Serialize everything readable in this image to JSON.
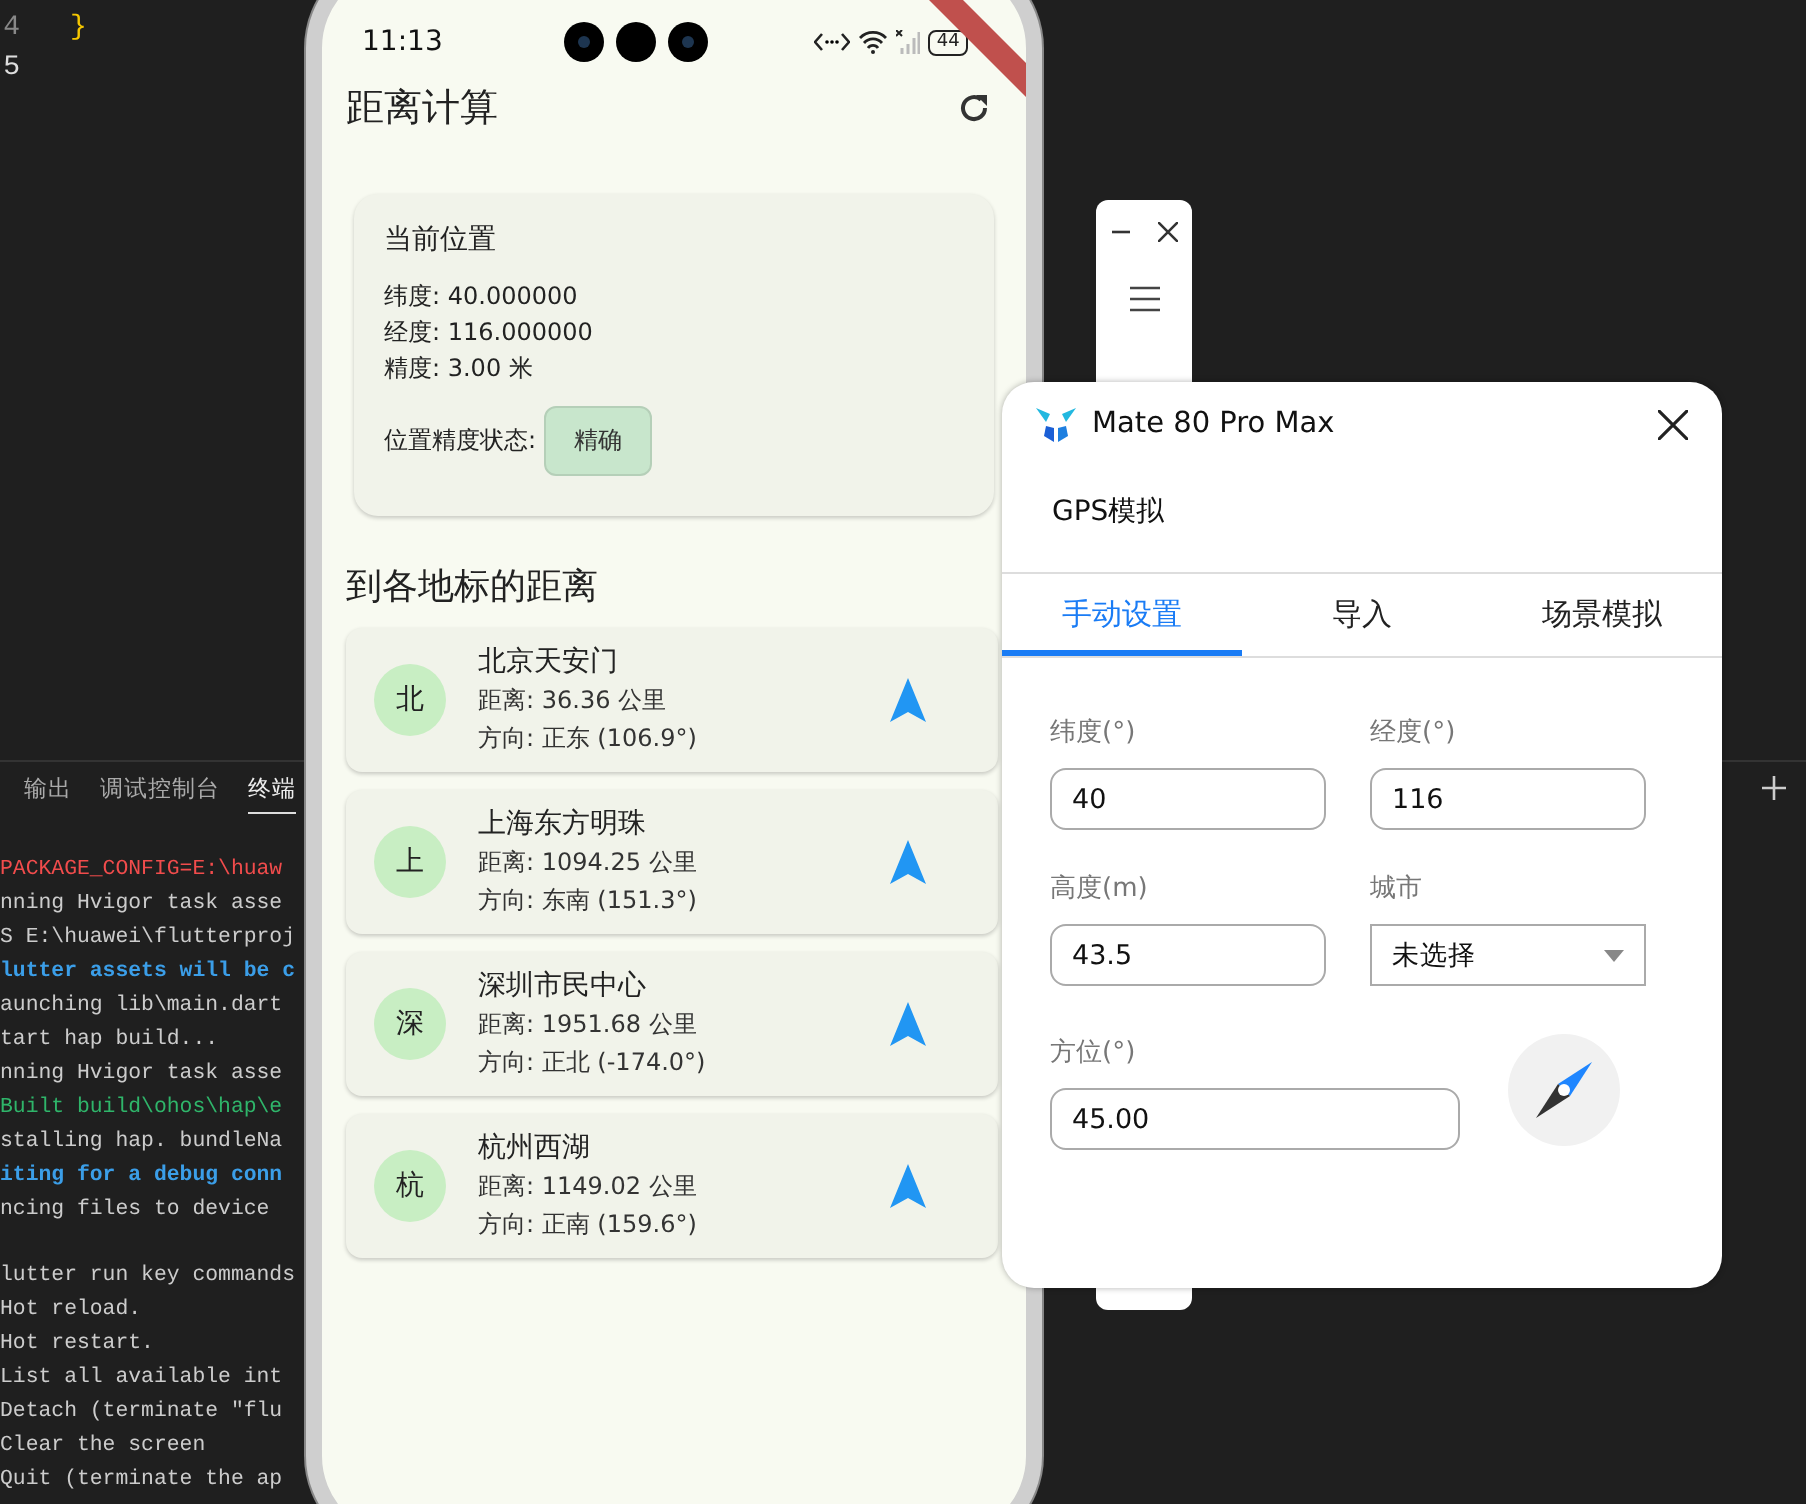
{
  "editor": {
    "line_numbers": [
      "4",
      "5"
    ],
    "code": "}"
  },
  "terminal": {
    "tabs": [
      {
        "label": "输出",
        "selected": false
      },
      {
        "label": "调试控制台",
        "selected": false
      },
      {
        "label": "终端",
        "selected": true
      }
    ],
    "lines": [
      {
        "text": "PACKAGE_CONFIG=E:\\huaw",
        "kind": "error"
      },
      {
        "text": "nning Hvigor task asse",
        "kind": "plain"
      },
      {
        "text": "S E:\\huawei\\flutterproj",
        "kind": "plain"
      },
      {
        "text": "lutter assets will be c",
        "kind": "info"
      },
      {
        "text": "aunching lib\\main.dart",
        "kind": "plain"
      },
      {
        "text": "tart hap build...",
        "kind": "plain"
      },
      {
        "text": "nning Hvigor task asse",
        "kind": "plain"
      },
      {
        "text": "Built build\\ohos\\hap\\e",
        "kind": "success"
      },
      {
        "text": "stalling hap. bundleNa",
        "kind": "plain"
      },
      {
        "text": "iting for a debug conn",
        "kind": "info"
      },
      {
        "text": "ncing files to device",
        "kind": "plain"
      }
    ],
    "key_commands": [
      "lutter run key commands",
      "Hot reload.",
      "Hot restart.",
      "List all available int",
      "Detach (terminate \"flu",
      "Clear the screen",
      "Quit (terminate the ap"
    ]
  },
  "phone": {
    "status_bar": {
      "time": "11:13",
      "battery": "44"
    },
    "app_bar": {
      "title": "距离计算"
    },
    "location_card": {
      "title": "当前位置",
      "lines": [
        "纬度: 40.000000",
        "经度: 116.000000",
        "精度: 3.00 米"
      ],
      "status_label": "位置精度状态:",
      "status_chip": "精确"
    },
    "section_title": "到各地标的距离",
    "landmarks": [
      {
        "initial": "北",
        "name": "北京天安门",
        "distance": "距离: 36.36 公里",
        "direction": "方向: 正东 (106.9°)"
      },
      {
        "initial": "上",
        "name": "上海东方明珠",
        "distance": "距离: 1094.25 公里",
        "direction": "方向: 东南 (151.3°)"
      },
      {
        "initial": "深",
        "name": "深圳市民中心",
        "distance": "距离: 1951.68 公里",
        "direction": "方向: 正北 (-174.0°)"
      },
      {
        "initial": "杭",
        "name": "杭州西湖",
        "distance": "距离: 1149.02 公里",
        "direction": "方向: 正南 (159.6°)"
      }
    ]
  },
  "gps_panel": {
    "window": {
      "title": "Mate 80 Pro Max"
    },
    "heading": "GPS模拟",
    "tabs": [
      {
        "label": "手动设置",
        "selected": true
      },
      {
        "label": "导入",
        "selected": false
      },
      {
        "label": "场景模拟",
        "selected": false
      }
    ],
    "fields": [
      {
        "label": "纬度(°)",
        "value": "40",
        "kind": "input"
      },
      {
        "label": "经度(°)",
        "value": "116",
        "kind": "input"
      },
      {
        "label": "高度(m)",
        "value": "43.5",
        "kind": "input"
      },
      {
        "label": "城市",
        "value": "未选择",
        "kind": "select"
      }
    ],
    "bearing": {
      "label": "方位(°)",
      "value": "45.00"
    }
  }
}
